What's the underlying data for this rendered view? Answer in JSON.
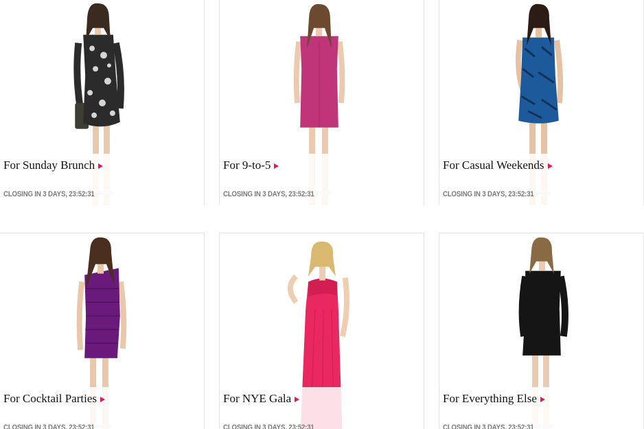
{
  "colors": {
    "accent_arrow": "#e0195c",
    "timer_text": "#7a7a7a",
    "card_border": "#e4e4e4"
  },
  "cards": [
    {
      "title": "For Sunday Brunch",
      "timer": "CLOSING IN 3 DAYS, 23:52:31",
      "image": "model-wearing-black-white-print-wrap-dress",
      "dress_color": "#2b2b2b",
      "hair_color": "#3a2a20"
    },
    {
      "title": "For 9-to-5",
      "timer": "CLOSING IN 3 DAYS, 23:52:31",
      "image": "model-wearing-magenta-sheath-dress",
      "dress_color": "#c0357a",
      "hair_color": "#6b4a30"
    },
    {
      "title": "For Casual Weekends",
      "timer": "CLOSING IN 3 DAYS, 23:52:31",
      "image": "model-wearing-blue-print-sleeveless-dress",
      "dress_color": "#1d5a9c",
      "hair_color": "#2b1d16"
    },
    {
      "title": "For Cocktail Parties",
      "timer": "CLOSING IN 3 DAYS, 23:52:31",
      "image": "model-wearing-purple-bandage-dress",
      "dress_color": "#6a1a7a",
      "hair_color": "#4a2e1e"
    },
    {
      "title": "For NYE Gala",
      "timer": "CLOSING IN 3 DAYS, 23:52:31",
      "image": "model-wearing-pink-strapless-gown",
      "dress_color": "#e8285f",
      "hair_color": "#d9b870"
    },
    {
      "title": "For Everything Else",
      "timer": "CLOSING IN 3 DAYS, 23:52:31",
      "image": "model-wearing-black-long-sleeve-dress",
      "dress_color": "#151515",
      "hair_color": "#8a6a44"
    }
  ]
}
